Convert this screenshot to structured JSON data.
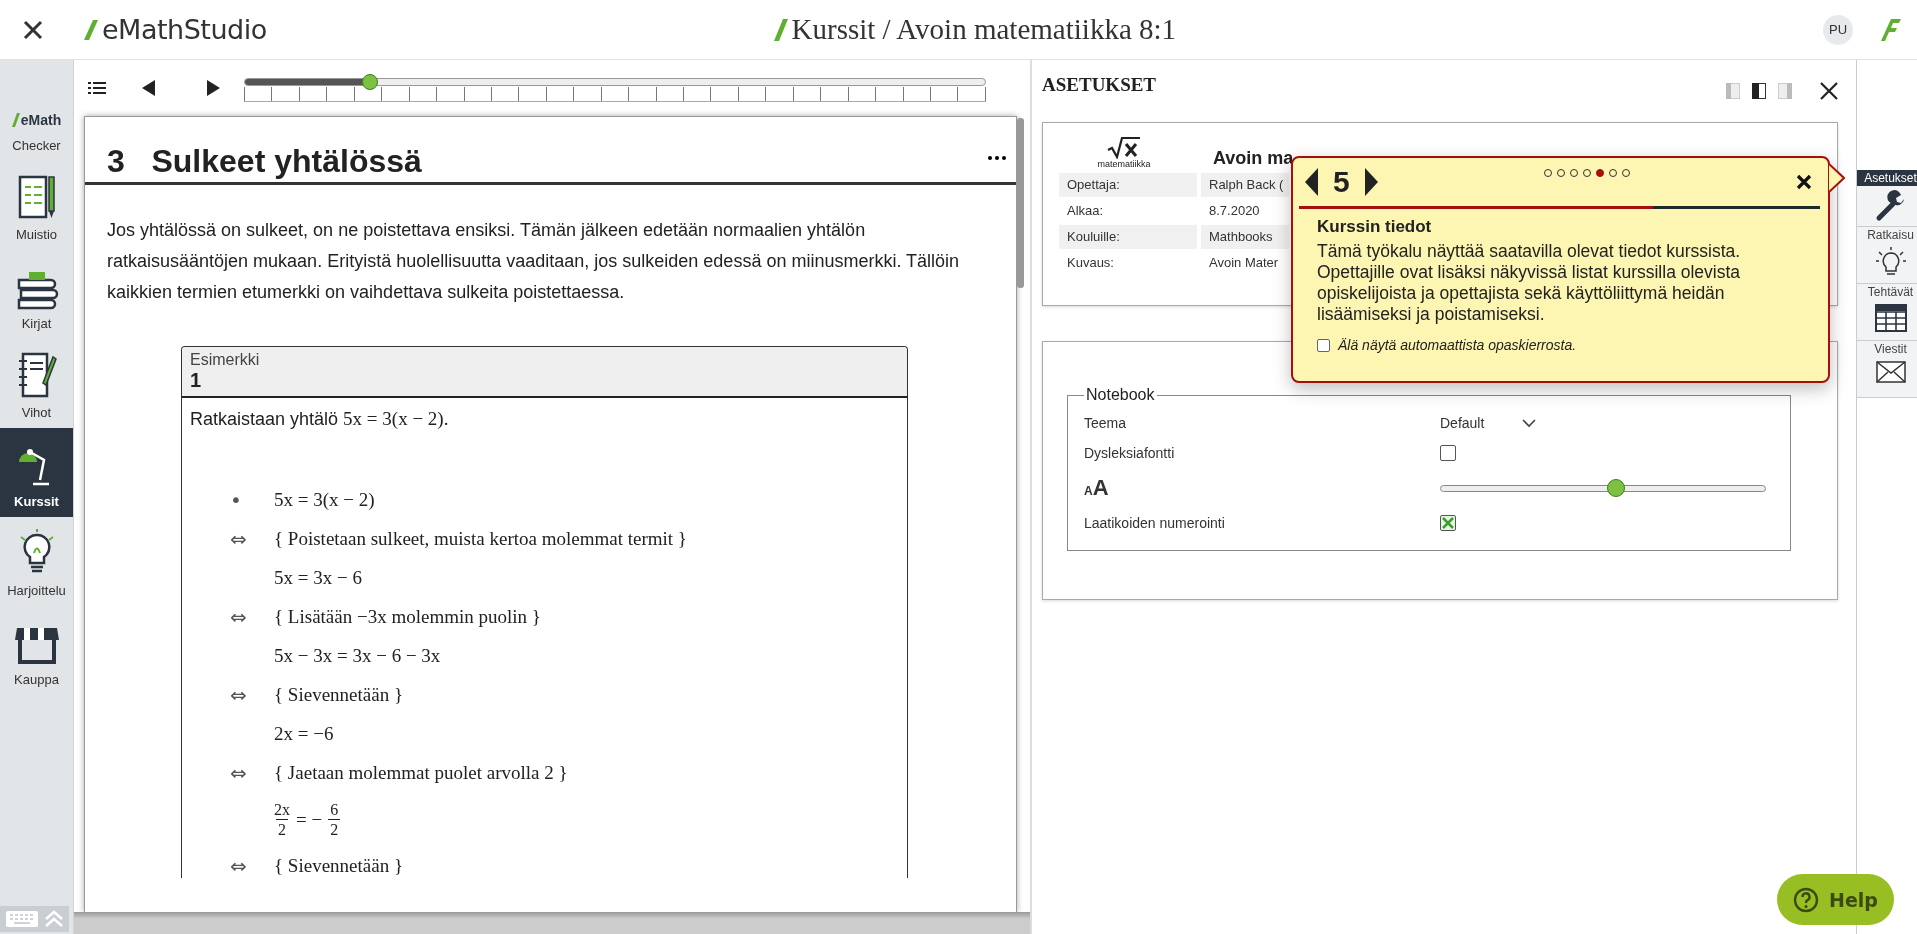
{
  "top_bar": {
    "app_name": "eMathStudio",
    "title": "Kurssit / Avoin matematiikka 8:1",
    "user_initials": "PU"
  },
  "sidebar": {
    "items": [
      {
        "kind": "checker",
        "logo": "eMath",
        "label": "Checker",
        "selected": false
      },
      {
        "kind": "notes",
        "label": "Muistio",
        "selected": false
      },
      {
        "kind": "books",
        "label": "Kirjat",
        "selected": false
      },
      {
        "kind": "notebook",
        "label": "Vihot",
        "selected": false
      },
      {
        "kind": "courses",
        "label": "Kurssit",
        "selected": true
      },
      {
        "kind": "practice",
        "label": "Harjoittelu",
        "selected": false
      },
      {
        "kind": "shop",
        "label": "Kauppa",
        "selected": false
      }
    ]
  },
  "toolbar": {
    "slider": {
      "level": 0.17
    }
  },
  "page": {
    "chapter_number": "3",
    "chapter_title": "Sulkeet yhtälössä",
    "paragraph": "Jos yhtälössä on sulkeet, on ne poistettava ensiksi. Tämän jälkeen edetään normaalien yhtälön ratkaisusääntöjen mukaan. Erityistä huolellisuutta vaaditaan, jos sulkeiden edessä on miinusmerkki. Tällöin kaikkien termien etumerkki on vaihdettava sulkeita poistettaessa.",
    "example": {
      "label": "Esimerkki",
      "number": "1",
      "intro": "Ratkaistaan yhtälö",
      "intro_math": "5x = 3(x − 2).",
      "steps": [
        {
          "kind": "line",
          "mark": "•",
          "text": "5x = 3(x − 2)"
        },
        {
          "kind": "line",
          "mark": "⇔",
          "text": "{ Poistetaan sulkeet, muista kertoa molemmat termit }"
        },
        {
          "kind": "line",
          "text": "5x = 3x − 6"
        },
        {
          "kind": "line",
          "mark": "⇔",
          "text": "{ Lisätään −3x molemmin puolin }"
        },
        {
          "kind": "line",
          "text": "5x − 3x = 3x − 6 − 3x"
        },
        {
          "kind": "line",
          "mark": "⇔",
          "text": "{ Sievennetään }"
        },
        {
          "kind": "line",
          "text": "2x = −6"
        },
        {
          "kind": "line",
          "mark": "⇔",
          "text": "{ Jaetaan molemmat puolet arvolla 2 }"
        },
        {
          "kind": "fraction",
          "left_num": "2x",
          "left_den": "2",
          "relation": "= −",
          "right_num": "6",
          "right_den": "2"
        },
        {
          "kind": "line",
          "mark": "⇔",
          "text": "{ Sievennetään }"
        }
      ]
    }
  },
  "settings": {
    "title": "ASETUKSET",
    "layout_options": [
      {
        "selected": false
      },
      {
        "selected": true
      },
      {
        "selected": false
      }
    ],
    "course": {
      "logo_caption": "matematiikka",
      "name": "Avoin ma",
      "fields": [
        {
          "label": "Opettaja:",
          "value": "Ralph Back ("
        },
        {
          "label": "Alkaa:",
          "value": "8.7.2020"
        },
        {
          "label": "Kouluille:",
          "value": "Mathbooks"
        },
        {
          "label": "Kuvaus:",
          "value": "Avoin Mater"
        }
      ]
    },
    "notebook": {
      "legend": "Notebook",
      "rows": [
        {
          "kind": "select",
          "label": "Teema",
          "value": "Default"
        },
        {
          "kind": "checkbox",
          "label": "Dysleksiafontti",
          "checked": false
        },
        {
          "kind": "slider",
          "small_glyph": "A",
          "large_glyph": "A",
          "level": 0.54
        },
        {
          "kind": "checkbox",
          "label": "Laatikoiden numerointi",
          "checked": true
        }
      ]
    }
  },
  "tour": {
    "step": "5",
    "dots": [
      {
        "selected": false
      },
      {
        "selected": false
      },
      {
        "selected": false
      },
      {
        "selected": false
      },
      {
        "selected": true
      },
      {
        "selected": false
      },
      {
        "selected": false
      }
    ],
    "progress": {
      "level": 0.68
    },
    "title": "Kurssin tiedot",
    "text": "Tämä työkalu näyttää saatavilla olevat tiedot kurssista. Opettajille ovat lisäksi näkyvissä listat kurssilla olevista opiskelijoista ja opettajista sekä käyttöliittymä heidän lisäämiseksi ja poistamiseksi.",
    "dont_show": {
      "label": "Älä näytä automaattista opaskierrosta.",
      "checked": false
    }
  },
  "right_sidebar": {
    "items": [
      {
        "kind": "settings",
        "label": "Asetukset",
        "selected": true
      },
      {
        "kind": "solution",
        "label": "Ratkaisu",
        "selected": false
      },
      {
        "kind": "tasks",
        "label": "Tehtävät",
        "selected": false
      },
      {
        "kind": "messages",
        "label": "Viestit",
        "selected": false
      }
    ]
  },
  "help": {
    "label": "Help"
  }
}
